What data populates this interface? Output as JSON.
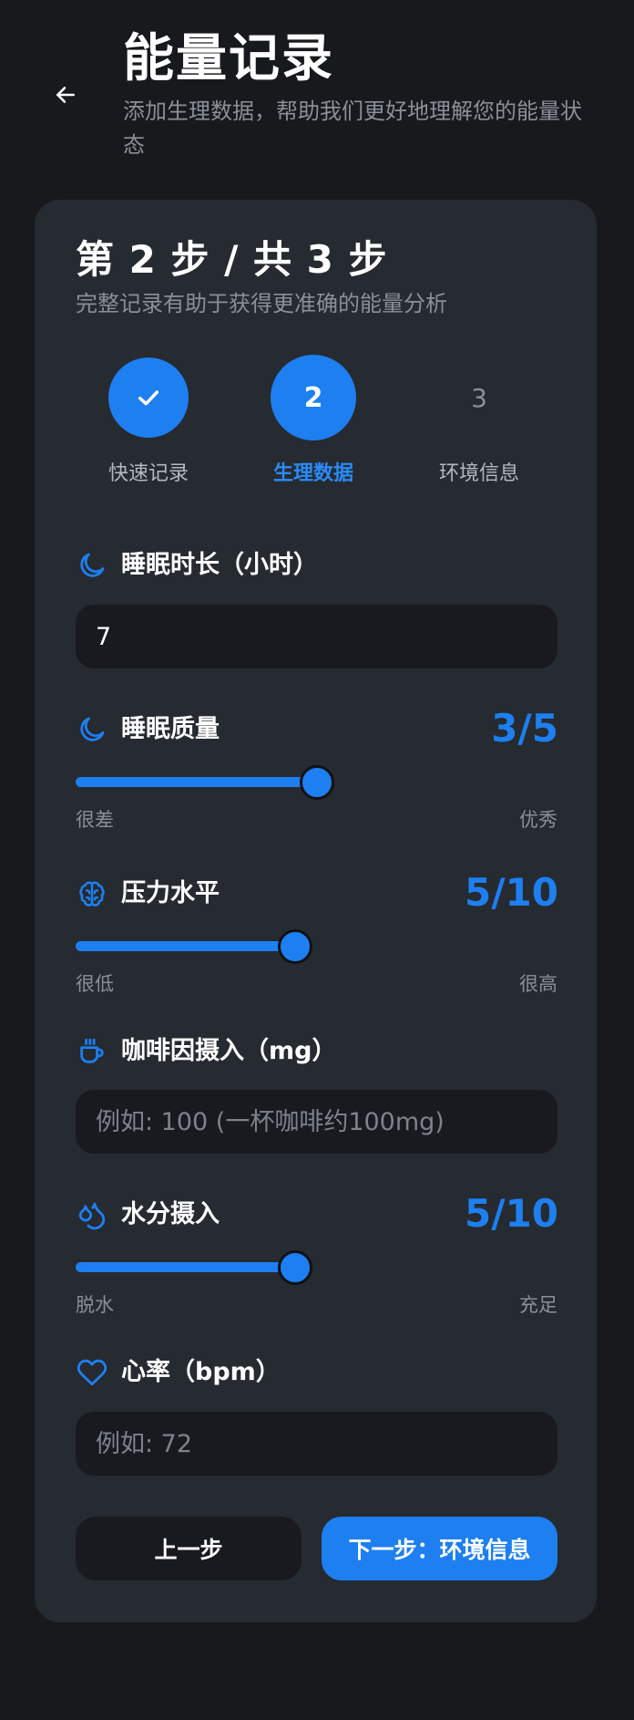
{
  "header": {
    "title": "能量记录",
    "subtitle": "添加生理数据，帮助我们更好地理解您的能量状态",
    "back_icon": "arrow-left-icon"
  },
  "card": {
    "step_title": "第 2 步 / 共 3 步",
    "step_subtitle": "完整记录有助于获得更准确的能量分析"
  },
  "stepper": {
    "steps": [
      {
        "number": "",
        "label": "快速记录",
        "state": "done",
        "icon": "check-icon"
      },
      {
        "number": "2",
        "label": "生理数据",
        "state": "active"
      },
      {
        "number": "3",
        "label": "环境信息",
        "state": "pending"
      }
    ]
  },
  "fields": {
    "sleep_duration": {
      "label": "睡眠时长（小时）",
      "icon": "moon-icon",
      "value": "7",
      "placeholder": ""
    },
    "sleep_quality": {
      "label": "睡眠质量",
      "icon": "moon-icon",
      "value_text": "3/5",
      "value": 3,
      "max": 5,
      "min_label": "很差",
      "max_label": "优秀"
    },
    "stress_level": {
      "label": "压力水平",
      "icon": "brain-icon",
      "value_text": "5/10",
      "value": 5,
      "max": 10,
      "min_label": "很低",
      "max_label": "很高"
    },
    "caffeine": {
      "label": "咖啡因摄入（mg）",
      "icon": "coffee-cup-icon",
      "value": "",
      "placeholder": "例如: 100 (一杯咖啡约100mg)"
    },
    "hydration": {
      "label": "水分摄入",
      "icon": "droplets-icon",
      "value_text": "5/10",
      "value": 5,
      "max": 10,
      "min_label": "脱水",
      "max_label": "充足"
    },
    "heart_rate": {
      "label": "心率（bpm）",
      "icon": "heart-icon",
      "value": "",
      "placeholder": "例如: 72"
    }
  },
  "actions": {
    "prev_label": "上一步",
    "next_label": "下一步：环境信息"
  },
  "colors": {
    "accent": "#1d7ff0",
    "background": "#17191d",
    "card": "#262a31",
    "input": "#181a1f",
    "muted_text": "#8a8f98"
  }
}
